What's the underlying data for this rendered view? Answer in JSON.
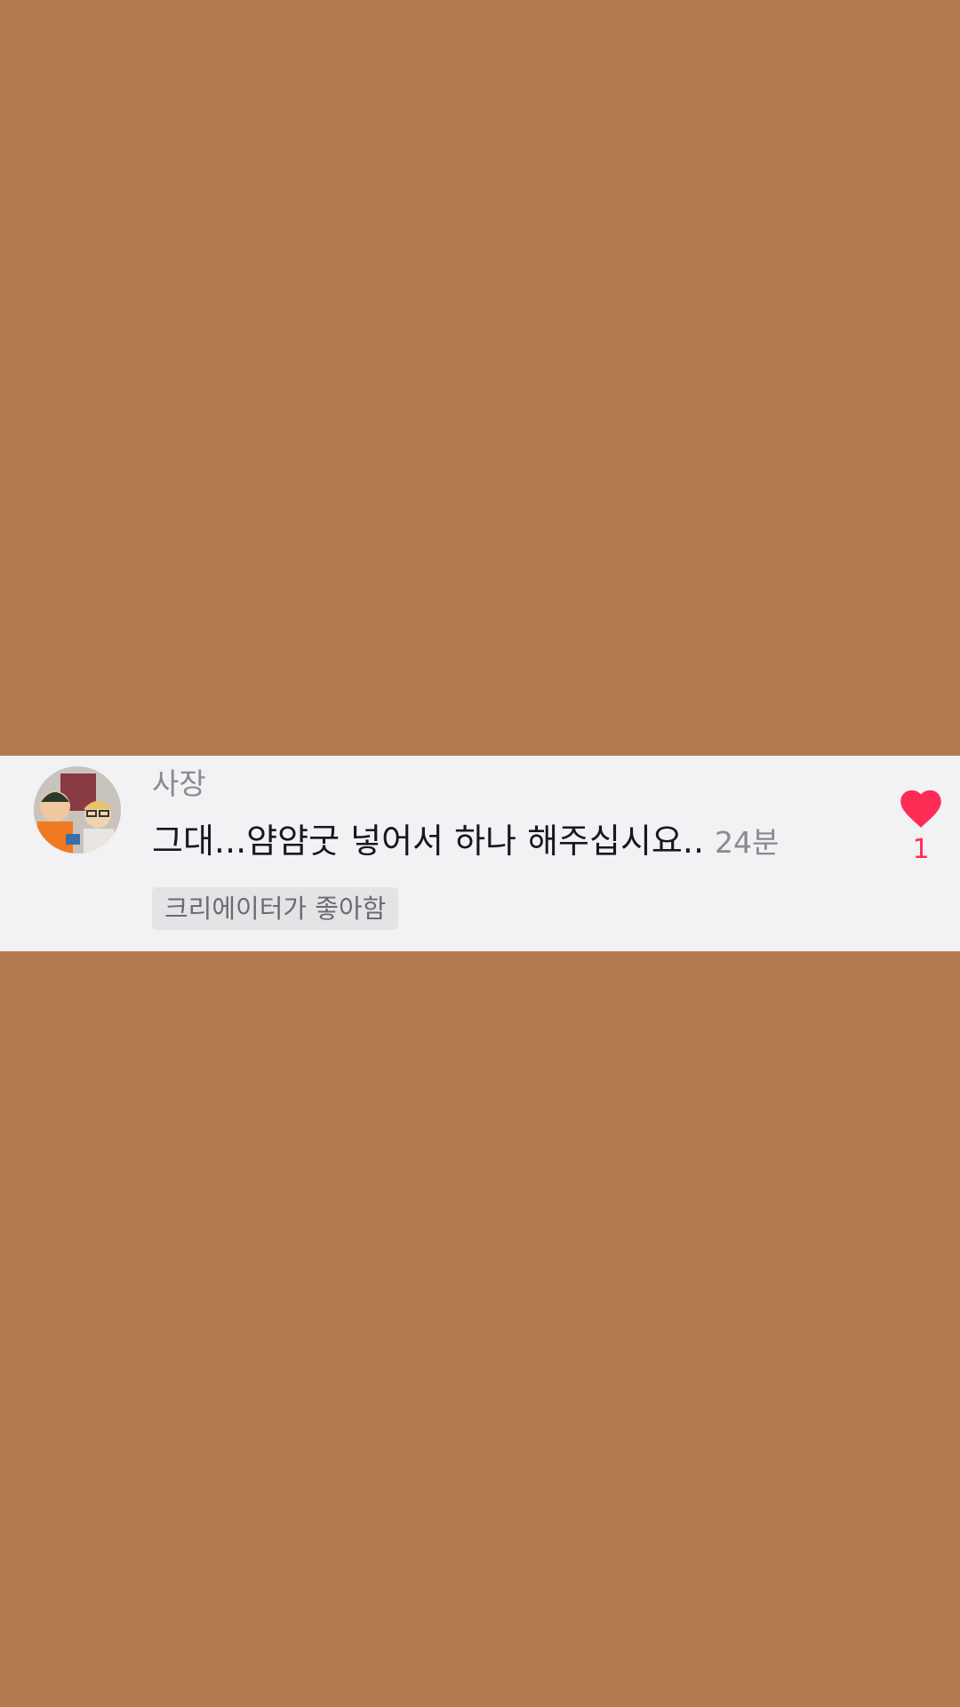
{
  "background_color": "#b57b50",
  "comment": {
    "username": "사장",
    "text": "그대...얌얌굿 넣어서 하나 해주십시요..",
    "timestamp": "24분",
    "creator_badge": "크리에이터가 좋아함",
    "like_count": "1",
    "liked": true,
    "accent_color": "#fe2c55",
    "avatar_icon": "user-avatar-icon",
    "like_icon": "heart-icon"
  }
}
